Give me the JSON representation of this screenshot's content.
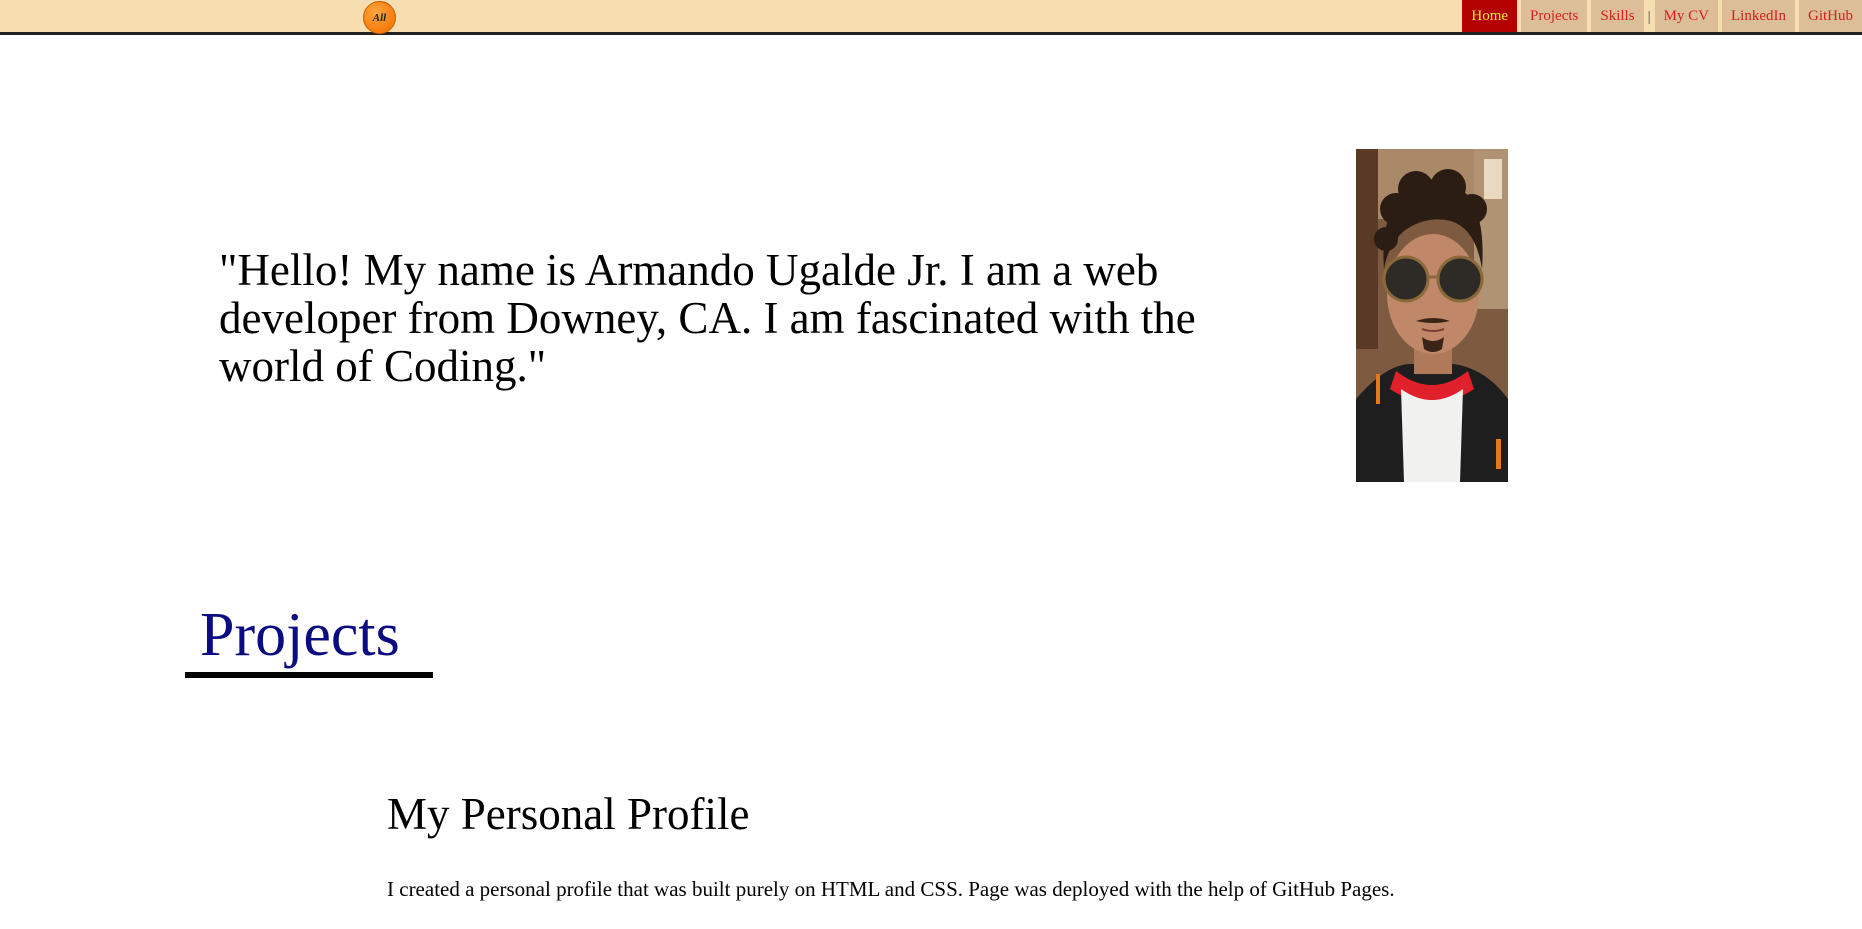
{
  "navbar": {
    "logo_text": "All",
    "links": [
      {
        "label": "Home",
        "active": true
      },
      {
        "label": "Projects",
        "active": false
      },
      {
        "label": "Skills",
        "active": false
      },
      {
        "label": "My CV",
        "active": false
      },
      {
        "label": "LinkedIn",
        "active": false
      },
      {
        "label": "GitHub",
        "active": false
      }
    ],
    "separator": "|"
  },
  "intro": {
    "quote": "\"Hello! My name is Armando Ugalde Jr. I am a web developer from Downey, CA. I am fascinated with the world of Coding.\""
  },
  "profile_photo": {
    "icon": "person-photo"
  },
  "projects": {
    "heading": "Projects",
    "items": [
      {
        "title": "My Personal Profile",
        "description": "I created a personal profile that was built purely on HTML and CSS. Page was deployed with the help of GitHub Pages."
      }
    ]
  },
  "colors": {
    "navbar_bg": "#f6deb0",
    "nav_active_bg": "#b30000",
    "nav_active_text": "#f3e63a",
    "nav_link_text": "#d31f1f",
    "projects_heading": "#0b0b82",
    "logo": "#f57b0c"
  }
}
